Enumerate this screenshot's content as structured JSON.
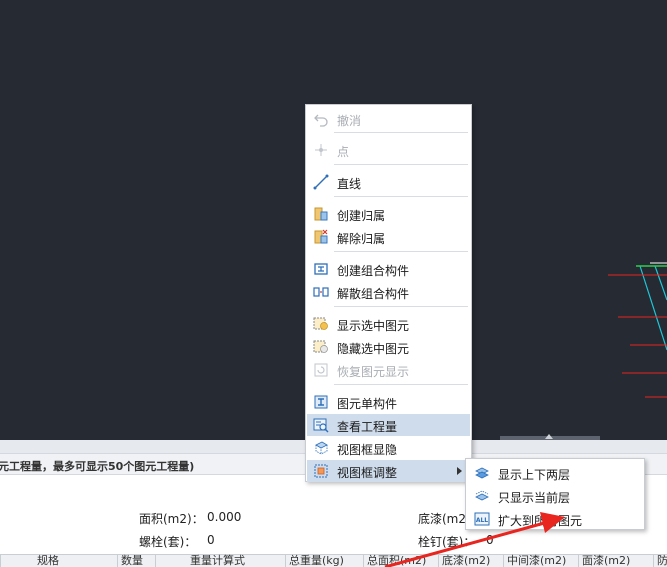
{
  "panel": {
    "header_text": "元工程量，最多可显示50个图元工程量)",
    "stats": {
      "area_label": "面积(m2)：",
      "area_value": "0.000",
      "bolt_label": "螺栓(套)：",
      "bolt_value": "0",
      "bottom_paint_label": "底漆(m2)",
      "peg_label": "栓钉(套)：",
      "peg_value": "0"
    },
    "table_headers": [
      "规格",
      "数量",
      "重量计算式",
      "总重量(kg)",
      "总面积(m2)",
      "底漆(m2)",
      "中间漆(m2)",
      "面漆(m2)",
      "防"
    ]
  },
  "context_menu": {
    "items": [
      {
        "label": "撤消",
        "icon": "undo-icon",
        "disabled": true
      },
      {
        "label": "点",
        "icon": "point-icon",
        "disabled": true
      },
      {
        "label": "直线",
        "icon": "line-icon",
        "disabled": false
      },
      {
        "label": "创建归属",
        "icon": "create-ownership-icon",
        "disabled": false
      },
      {
        "label": "解除归属",
        "icon": "remove-ownership-icon",
        "disabled": false
      },
      {
        "label": "创建组合构件",
        "icon": "create-group-icon",
        "disabled": false
      },
      {
        "label": "解散组合构件",
        "icon": "dissolve-group-icon",
        "disabled": false
      },
      {
        "label": "显示选中图元",
        "icon": "show-selected-icon",
        "disabled": false
      },
      {
        "label": "隐藏选中图元",
        "icon": "hide-selected-icon",
        "disabled": false
      },
      {
        "label": "恢复图元显示",
        "icon": "restore-display-icon",
        "disabled": true
      },
      {
        "label": "图元单构件",
        "icon": "single-component-icon",
        "disabled": false
      },
      {
        "label": "查看工程量",
        "icon": "view-quantity-icon",
        "disabled": false
      },
      {
        "label": "视图框显隐",
        "icon": "view-frame-toggle-icon",
        "disabled": false
      },
      {
        "label": "视图框调整",
        "icon": "view-frame-adjust-icon",
        "disabled": false
      }
    ]
  },
  "submenu": {
    "items": [
      {
        "label": "显示上下两层",
        "icon": "layers-up-down-icon"
      },
      {
        "label": "只显示当前层",
        "icon": "current-layer-icon"
      },
      {
        "label": "扩大到所有图元",
        "icon": "expand-all-icon",
        "badge": "ALL"
      }
    ]
  },
  "colors": {
    "canvas": "#252a33",
    "highlight": "#cfdcec",
    "annotation_arrow": "#e8251f",
    "cad_red": "#e8251f",
    "cad_cyan": "#1fc8d8",
    "cad_green": "#2fd04a"
  }
}
